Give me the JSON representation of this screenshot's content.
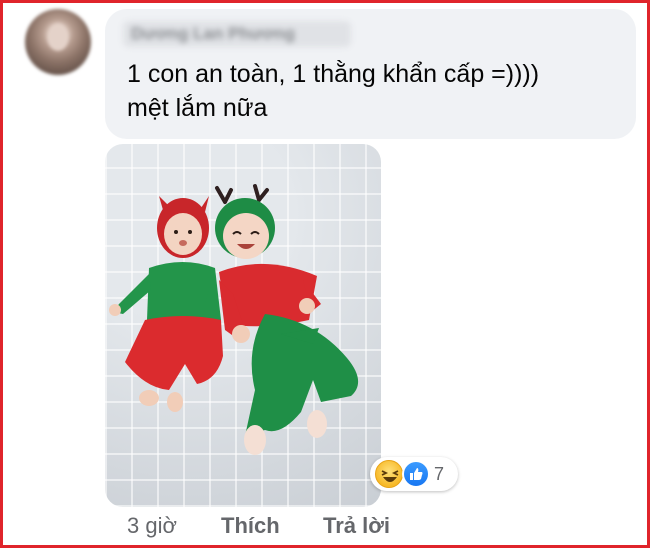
{
  "comment": {
    "author_name": "Dương Lan Phương",
    "text_lines": [
      "1 con an toàn, 1 thằng khẩn cấp =))))",
      "mệt lắm nữa"
    ]
  },
  "reactions": {
    "icons": [
      "haha-reaction-icon",
      "like-reaction-icon"
    ],
    "count": "7"
  },
  "meta": {
    "time": "3 giờ",
    "like_label": "Thích",
    "reply_label": "Trả lời"
  },
  "colors": {
    "frame_border": "#e0242b",
    "bubble_bg": "#f0f2f5",
    "meta_text": "#65676b",
    "like_blue": "#1877f2",
    "haha_yellow": "#f7b928"
  }
}
